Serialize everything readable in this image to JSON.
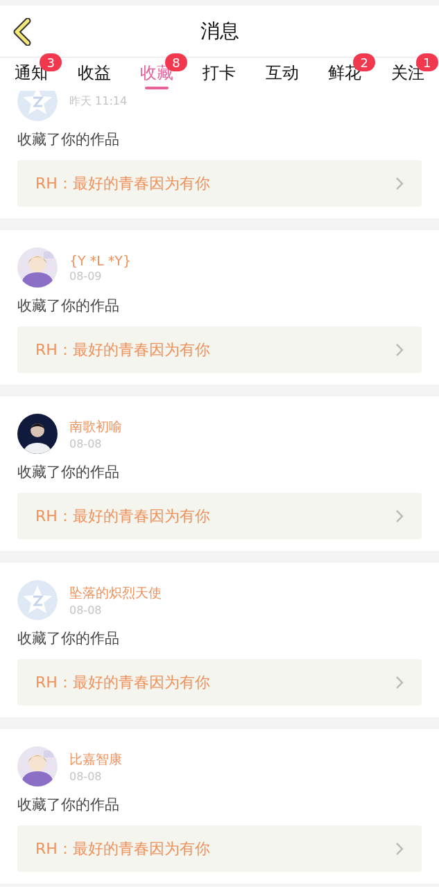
{
  "header": {
    "title": "消息"
  },
  "tabs": [
    {
      "label": "通知",
      "selected": false,
      "badge": "3"
    },
    {
      "label": "收益",
      "selected": false
    },
    {
      "label": "收藏",
      "selected": true,
      "badge": "8"
    },
    {
      "label": "打卡",
      "selected": false
    },
    {
      "label": "互动",
      "selected": false
    },
    {
      "label": "鲜花",
      "selected": false,
      "badge": "2"
    },
    {
      "label": "关注",
      "selected": false,
      "badge": "1"
    }
  ],
  "messages": [
    {
      "avatar": {
        "kind": "default"
      },
      "time": "昨天 11:14",
      "text": "收藏了你的作品",
      "work": "RH：最好的青春因为有你"
    },
    {
      "name": "{Y *L *Y}",
      "time": "08-09",
      "text": "收藏了你的作品",
      "work": "RH：最好的青春因为有你"
    },
    {
      "avatar": {
        "kind": "person"
      },
      "name": "南歌初喻",
      "time": "08-08",
      "text": "收藏了你的作品",
      "work": "RH：最好的青春因为有你"
    },
    {
      "avatar": {
        "kind": "default"
      },
      "name": "坠落的炽烈天使",
      "time": "08-08",
      "text": "收藏了你的作品",
      "work": "RH：最好的青春因为有你"
    },
    {
      "name": "比嘉智康",
      "time": "08-08",
      "text": "收藏了你的作品",
      "work": "RH：最好的青春因为有你"
    }
  ]
}
